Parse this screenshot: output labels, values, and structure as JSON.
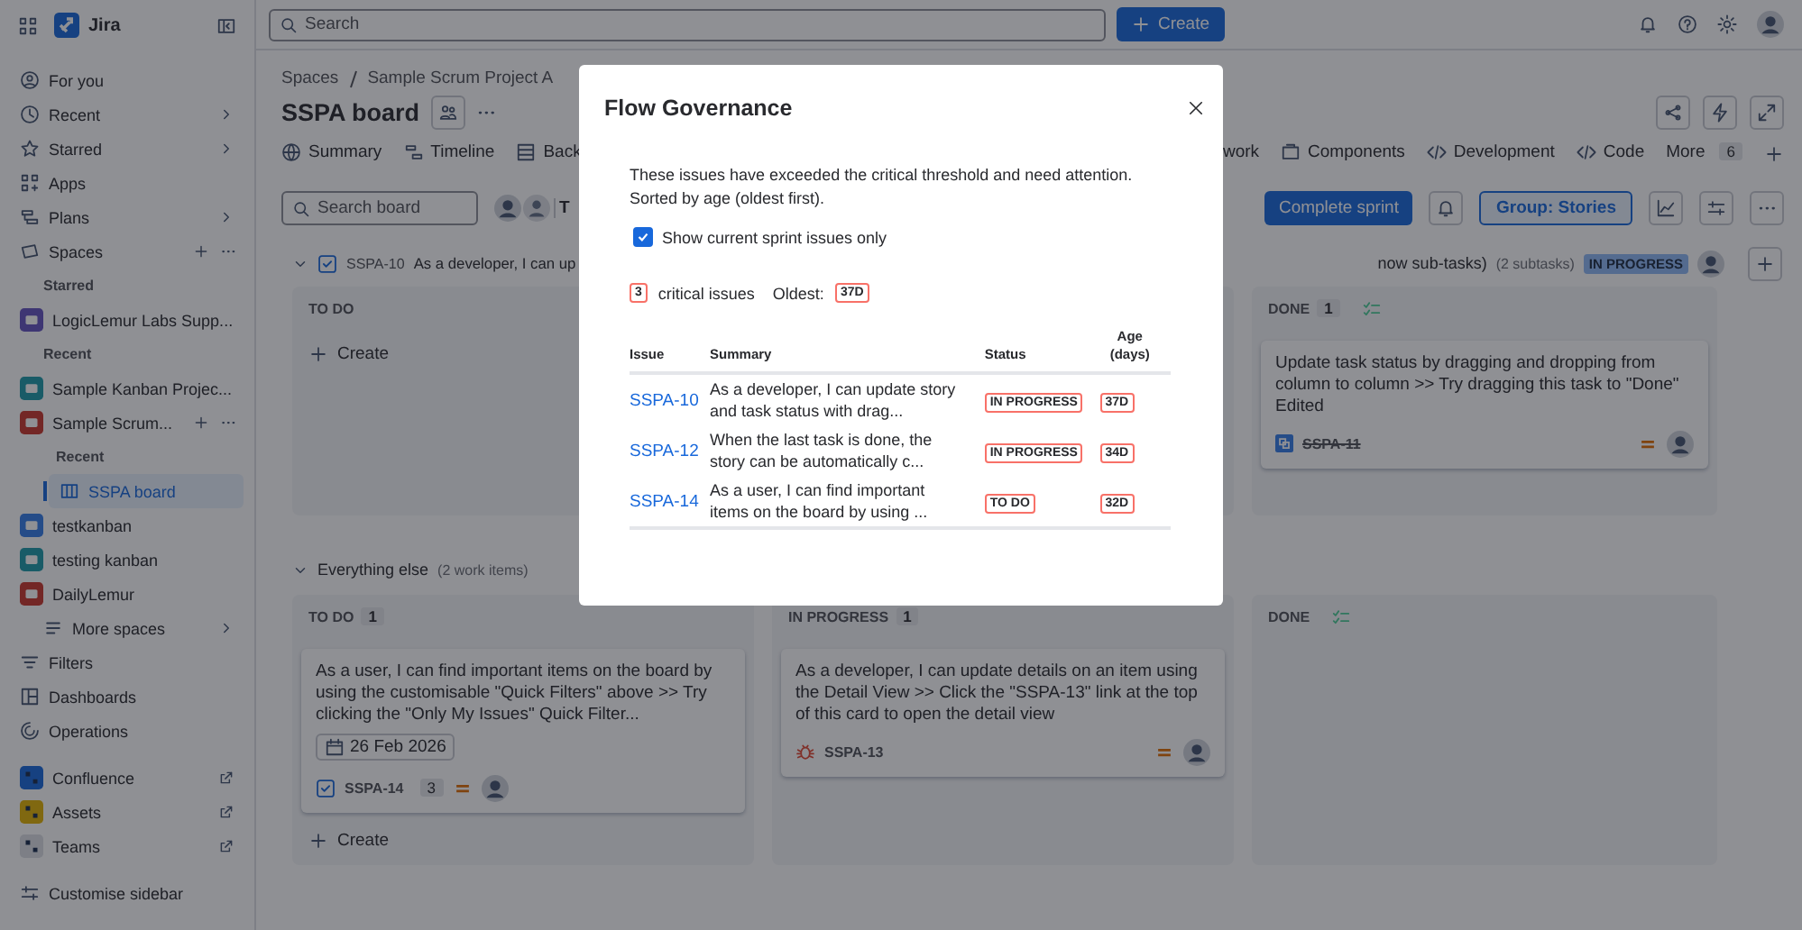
{
  "app": {
    "name": "Jira"
  },
  "sidebar": {
    "nav": [
      {
        "label": "For you",
        "submenu": false
      },
      {
        "label": "Recent",
        "submenu": true
      },
      {
        "label": "Starred",
        "submenu": true
      },
      {
        "label": "Apps",
        "submenu": false
      },
      {
        "label": "Plans",
        "submenu": true
      }
    ],
    "spaces": {
      "label": "Spaces",
      "groups": [
        {
          "heading": "Starred",
          "items": [
            {
              "name": "LogicLemur Labs Supp...",
              "expanded": false
            }
          ]
        },
        {
          "heading": "Recent",
          "items": [
            {
              "name": "Sample Kanban Projec...",
              "expanded": false
            },
            {
              "name": "Sample Scrum...",
              "expanded": true,
              "recent_heading": "Recent",
              "boards": [
                {
                  "name": "SSPA board",
                  "selected": true
                }
              ]
            },
            {
              "name": "testkanban",
              "expanded": false
            },
            {
              "name": "testing kanban",
              "expanded": false
            },
            {
              "name": "DailyLemur",
              "expanded": false
            }
          ]
        }
      ],
      "more": "More spaces"
    },
    "nav2": [
      {
        "label": "Filters"
      },
      {
        "label": "Dashboards"
      },
      {
        "label": "Operations"
      }
    ],
    "apps": [
      {
        "label": "Confluence"
      },
      {
        "label": "Assets"
      },
      {
        "label": "Teams"
      }
    ],
    "footer": "Customise sidebar"
  },
  "topbar": {
    "search": {
      "placeholder": "Search"
    },
    "create": "Create"
  },
  "page": {
    "breadcrumb": [
      "Spaces",
      "Sample Scrum Project A"
    ],
    "title": "SSPA board",
    "tabs": [
      {
        "label": "Summary",
        "selected": false
      },
      {
        "label": "Timeline",
        "selected": false
      },
      {
        "label": "Back",
        "selected": false
      },
      {
        "label": "work",
        "selected": false
      },
      {
        "label": "Components",
        "selected": false
      },
      {
        "label": "Development",
        "selected": false
      },
      {
        "label": "Code",
        "selected": false
      }
    ],
    "more": {
      "label": "More",
      "count": "6"
    }
  },
  "toolbar": {
    "search": {
      "placeholder": "Search board"
    },
    "filter_button": "T",
    "complete": "Complete sprint",
    "group": "Group: Stories"
  },
  "board": {
    "lanes": [
      {
        "kind": "story",
        "key": "SSPA-10",
        "title": "As a developer, I can up",
        "title_end": "now sub-tasks)",
        "subtasks": "(2 subtasks)",
        "status": "IN PROGRESS",
        "expanded": true,
        "columns": [
          {
            "kind": "todo",
            "title": "TO DO",
            "create": "Create"
          },
          {
            "kind": "inprogress"
          },
          {
            "kind": "done",
            "title": "DONE",
            "count": "1",
            "cards": [
              {
                "kind": "subtask",
                "summary": "Update task status by dragging and dropping from column to column >> Try dragging this task to \"Done\" Edited",
                "key": "SSPA-11",
                "done": true
              }
            ]
          }
        ]
      },
      {
        "kind": "group",
        "title": "Everything else",
        "count": "(2 work items)",
        "expanded": true,
        "columns": [
          {
            "kind": "todo",
            "title": "TO DO",
            "count": "1",
            "create": "Create",
            "cards": [
              {
                "kind": "story",
                "summary": "As a user, I can find important items on the board by using the customisable \"Quick Filters\" above >> Try clicking the \"Only My Issues\" Quick Filter...",
                "due": "26 Feb 2026",
                "key": "SSPA-14",
                "done": false,
                "subtasks": "3"
              }
            ]
          },
          {
            "kind": "inprogress",
            "title": "IN PROGRESS",
            "count": "1",
            "cards": [
              {
                "kind": "bug",
                "summary": "As a developer, I can update details on an item using the Detail View >> Click the \"SSPA-13\" link at the top of this card to open the detail view",
                "key": "SSPA-13",
                "done": false
              }
            ]
          },
          {
            "kind": "done",
            "title": "DONE"
          }
        ]
      }
    ]
  },
  "dialog": {
    "title": "Flow Governance",
    "description": "These issues have exceeded the critical threshold and need attention.\nSorted by age (oldest first).",
    "filter": {
      "label": "Show current sprint issues only",
      "checked": true
    },
    "summary": {
      "count": "3",
      "label": "critical issues",
      "oldest_label": "Oldest:",
      "oldest": "37D"
    },
    "table": {
      "columns": [
        "Issue",
        "Summary",
        "Status",
        "Age\n(days)"
      ],
      "rows": [
        {
          "issue": "SSPA-10",
          "summary": "As a developer, I can update story and task status with drag...",
          "status": "IN PROGRESS",
          "age": "37D"
        },
        {
          "issue": "SSPA-12",
          "summary": "When the last task is done, the story can be automatically c...",
          "status": "IN PROGRESS",
          "age": "34D"
        },
        {
          "issue": "SSPA-14",
          "summary": "As a user, I can find important items on the board by using ...",
          "status": "TO DO",
          "age": "32D"
        }
      ]
    }
  }
}
